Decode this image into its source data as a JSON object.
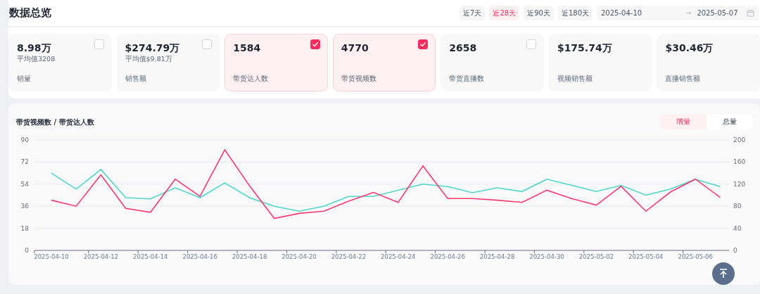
{
  "header": {
    "title": "数据总览"
  },
  "ranges": [
    {
      "label": "近7天",
      "selected": false
    },
    {
      "label": "近28天",
      "selected": true
    },
    {
      "label": "近90天",
      "selected": false
    },
    {
      "label": "近180天",
      "selected": false
    }
  ],
  "date_range": {
    "start": "2025-04-10",
    "separator": "→",
    "end": "2025-05-07"
  },
  "cards": [
    {
      "value": "8.98万",
      "average": "平均值3208",
      "label": "销量",
      "checked": false
    },
    {
      "value": "$274.79万",
      "average": "平均值$9.81万",
      "label": "销售额",
      "checked": false
    },
    {
      "value": "1584",
      "label": "带货达人数",
      "checked": true
    },
    {
      "value": "4770",
      "label": "带货视频数",
      "checked": true
    },
    {
      "value": "2658",
      "label": "带货直播数",
      "checked": false
    },
    {
      "value": "$175.74万",
      "label": "视频销售额"
    },
    {
      "value": "$30.46万",
      "label": "直播销售额"
    }
  ],
  "chart_panel": {
    "title": "带货视频数 / 带货达人数",
    "toggle": [
      {
        "label": "增量",
        "selected": true
      },
      {
        "label": "总量",
        "selected": false
      }
    ],
    "chart_data": {
      "type": "line",
      "categories": [
        "2025-04-10",
        null,
        "2025-04-12",
        null,
        "2025-04-14",
        null,
        "2025-04-16",
        null,
        "2025-04-18",
        null,
        "2025-04-20",
        null,
        "2025-04-22",
        null,
        "2025-04-24",
        null,
        "2025-04-26",
        null,
        "2025-04-28",
        null,
        "2025-04-30",
        null,
        "2025-05-02",
        null,
        "2025-05-04",
        null,
        "2025-05-06",
        null
      ],
      "grid": true,
      "ylim": [
        0,
        90
      ],
      "yticks": [
        0,
        18,
        36,
        54,
        72,
        90
      ],
      "y2lim": [
        0,
        200
      ],
      "y2ticks": [
        0,
        40,
        80,
        120,
        160,
        200
      ],
      "series": [
        {
          "color": "#4fd8c9",
          "values": [
            63,
            50,
            66,
            43,
            42,
            51,
            43,
            55,
            43,
            36,
            32,
            36,
            44,
            44,
            49,
            54,
            52,
            47,
            51,
            48,
            58,
            53,
            48,
            53,
            45,
            50,
            58,
            52
          ]
        },
        {
          "color": "#ff3a70",
          "axis": "y2",
          "values": [
            91,
            80,
            137,
            76,
            69,
            129,
            98,
            182,
            117,
            58,
            67,
            71,
            89,
            105,
            87,
            153,
            94,
            94,
            91,
            87,
            109,
            94,
            82,
            116,
            71,
            106,
            129,
            96
          ]
        }
      ]
    }
  }
}
